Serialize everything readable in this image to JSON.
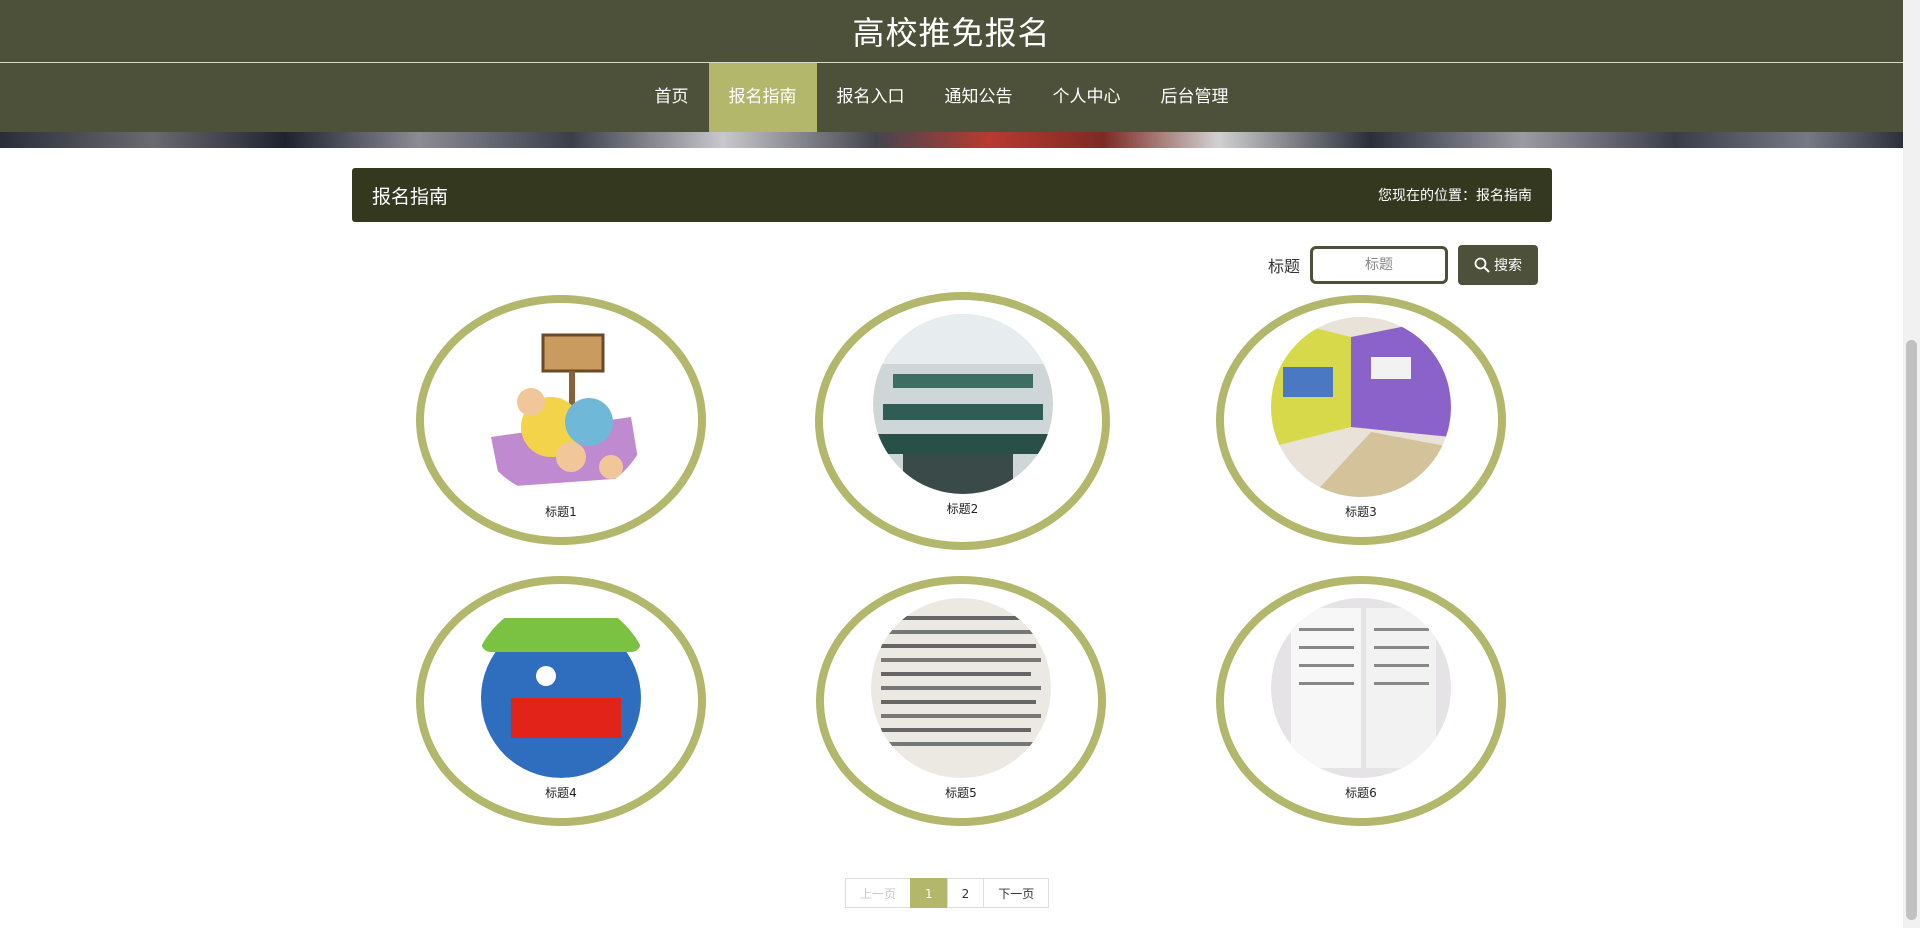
{
  "header": {
    "title": "高校推免报名"
  },
  "nav": {
    "items": [
      {
        "label": "首页"
      },
      {
        "label": "报名指南"
      },
      {
        "label": "报名入口"
      },
      {
        "label": "通知公告"
      },
      {
        "label": "个人中心"
      },
      {
        "label": "后台管理"
      }
    ],
    "active_index": 1
  },
  "section": {
    "title": "报名指南",
    "breadcrumb": "您现在的位置：报名指南"
  },
  "search": {
    "label": "标题",
    "placeholder": "标题",
    "button_label": "搜索"
  },
  "cards": [
    {
      "title": "标题1"
    },
    {
      "title": "标题2"
    },
    {
      "title": "标题3"
    },
    {
      "title": "标题4"
    },
    {
      "title": "标题5"
    },
    {
      "title": "标题6"
    }
  ],
  "pagination": {
    "prev": "上一页",
    "pages": [
      "1",
      "2"
    ],
    "current": "1",
    "next": "下一页"
  },
  "colors": {
    "header_bg": "#4e5139",
    "accent": "#b3b76c",
    "section_bg": "#33381f"
  }
}
